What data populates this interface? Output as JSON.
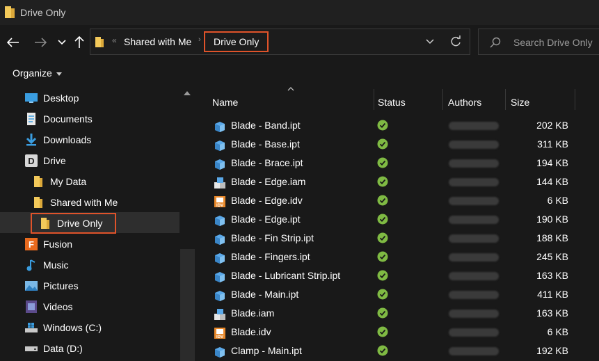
{
  "window": {
    "title": "Drive Only"
  },
  "nav": {
    "breadcrumb": [
      {
        "label": "Shared with Me"
      },
      {
        "label": "Drive Only"
      }
    ],
    "search_placeholder": "Search Drive Only"
  },
  "toolbar": {
    "organize_label": "Organize"
  },
  "sidebar": {
    "items": [
      {
        "label": "Desktop",
        "icon": "desktop-icon",
        "level": 0
      },
      {
        "label": "Documents",
        "icon": "documents-icon",
        "level": 0
      },
      {
        "label": "Downloads",
        "icon": "download-icon",
        "level": 0
      },
      {
        "label": "Drive",
        "icon": "drive-icon",
        "level": 0
      },
      {
        "label": "My Data",
        "icon": "folder-icon",
        "level": 1
      },
      {
        "label": "Shared with Me",
        "icon": "folder-icon",
        "level": 1
      },
      {
        "label": "Drive Only",
        "icon": "folder-icon",
        "level": 2,
        "selected": true
      },
      {
        "label": "Fusion",
        "icon": "fusion-icon",
        "level": 0
      },
      {
        "label": "Music",
        "icon": "music-icon",
        "level": 0
      },
      {
        "label": "Pictures",
        "icon": "pictures-icon",
        "level": 0
      },
      {
        "label": "Videos",
        "icon": "videos-icon",
        "level": 0
      },
      {
        "label": "Windows (C:)",
        "icon": "windows-drive-icon",
        "level": 0
      },
      {
        "label": "Data (D:)",
        "icon": "disk-drive-icon",
        "level": 0
      }
    ]
  },
  "table": {
    "columns": {
      "name": "Name",
      "status": "Status",
      "authors": "Authors",
      "size": "Size"
    },
    "rows": [
      {
        "name": "Blade - Band.ipt",
        "type": "ipt",
        "size": "202 KB"
      },
      {
        "name": "Blade - Base.ipt",
        "type": "ipt",
        "size": "311 KB"
      },
      {
        "name": "Blade - Brace.ipt",
        "type": "ipt",
        "size": "194 KB"
      },
      {
        "name": "Blade - Edge.iam",
        "type": "iam",
        "size": "144 KB"
      },
      {
        "name": "Blade - Edge.idv",
        "type": "idv",
        "size": "6 KB"
      },
      {
        "name": "Blade - Edge.ipt",
        "type": "ipt",
        "size": "190 KB"
      },
      {
        "name": "Blade - Fin Strip.ipt",
        "type": "ipt",
        "size": "188 KB"
      },
      {
        "name": "Blade - Fingers.ipt",
        "type": "ipt",
        "size": "245 KB"
      },
      {
        "name": "Blade - Lubricant Strip.ipt",
        "type": "ipt",
        "size": "163 KB"
      },
      {
        "name": "Blade - Main.ipt",
        "type": "ipt",
        "size": "411 KB"
      },
      {
        "name": "Blade.iam",
        "type": "iam",
        "size": "163 KB"
      },
      {
        "name": "Blade.idv",
        "type": "idv",
        "size": "6 KB"
      },
      {
        "name": "Clamp - Main.ipt",
        "type": "ipt",
        "size": "192 KB"
      }
    ]
  },
  "colors": {
    "highlight": "#e0532a",
    "status_ok": "#7fba43",
    "part_blue": "#5aa8e8",
    "folder": "#f3c95a"
  }
}
